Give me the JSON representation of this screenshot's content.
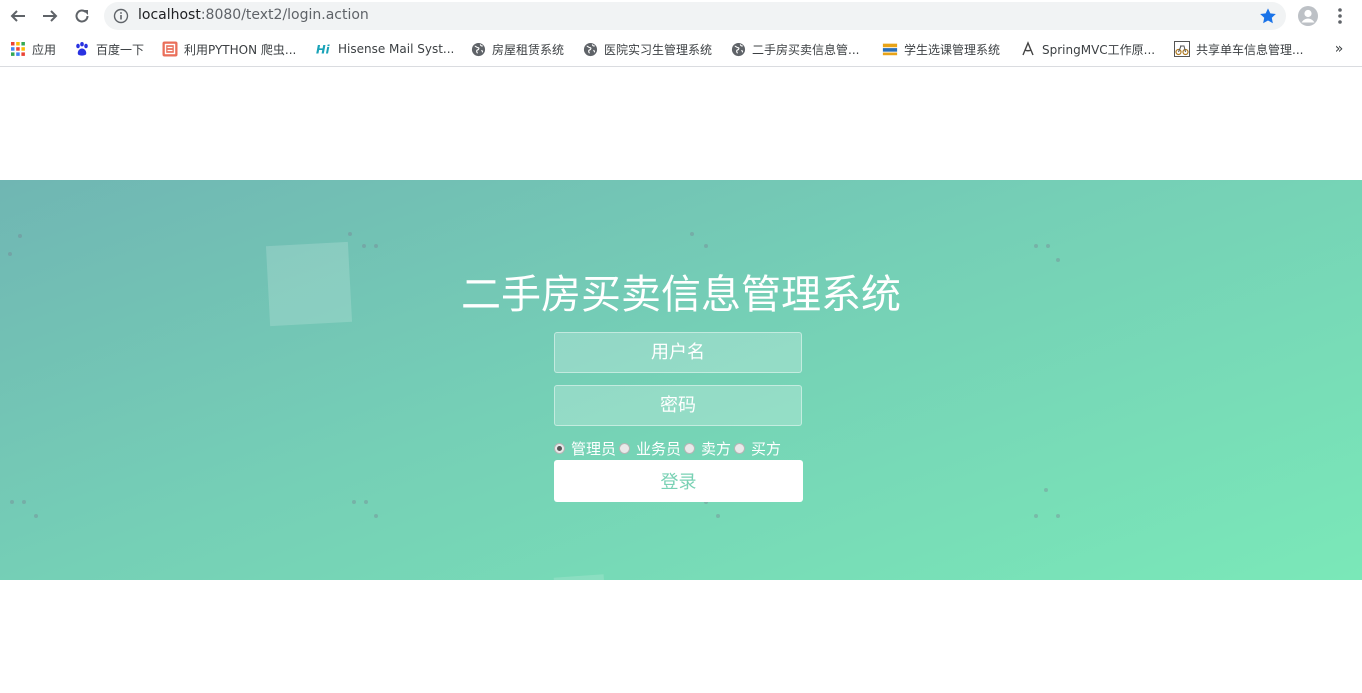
{
  "browser": {
    "url_host": "localhost",
    "url_rest": ":8080/text2/login.action",
    "bookmarks": [
      {
        "label": "应用",
        "icon": "apps-grid-icon"
      },
      {
        "label": "百度一下",
        "icon": "baidu-paw-icon"
      },
      {
        "label": "利用PYTHON 爬虫...",
        "icon": "jian-red-icon"
      },
      {
        "label": "Hisense Mail Syst...",
        "icon": "hisense-hi-icon"
      },
      {
        "label": "房屋租赁系统",
        "icon": "globe-icon"
      },
      {
        "label": "医院实习生管理系统",
        "icon": "globe-icon"
      },
      {
        "label": "二手房买卖信息管...",
        "icon": "globe-icon"
      },
      {
        "label": "学生选课管理系统",
        "icon": "book-stack-icon"
      },
      {
        "label": "SpringMVC工作原...",
        "icon": "spring-leaf-icon"
      },
      {
        "label": "共享单车信息管理...",
        "icon": "bike-image-icon"
      }
    ],
    "more_label": "»"
  },
  "page": {
    "title": "二手房买卖信息管理系统",
    "username_placeholder": "用户名",
    "password_placeholder": "密码",
    "roles": [
      {
        "label": "管理员",
        "checked": true
      },
      {
        "label": "业务员",
        "checked": false
      },
      {
        "label": "卖方",
        "checked": false
      },
      {
        "label": "买方",
        "checked": false
      }
    ],
    "login_label": "登录"
  },
  "colors": {
    "gradient_start": "#70b6b3",
    "gradient_end": "#7ae8b8",
    "login_text": "#79d1b4",
    "star": "#1a73e8"
  }
}
